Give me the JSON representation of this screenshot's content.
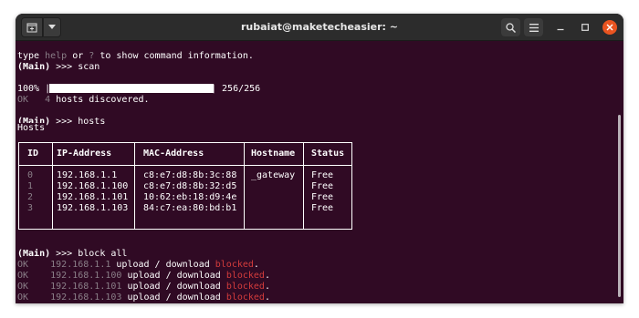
{
  "window": {
    "title": "rubaiat@maketecheasier: ~"
  },
  "colors": {
    "terminal_bg": "#300a24",
    "titlebar_bg": "#2c2c2c",
    "close_button": "#e95420",
    "blocked_red": "#d43c3c",
    "dim_text": "#8a7f88"
  },
  "icons": {
    "new_tab": "new-tab-icon",
    "dropdown": "chevron-down-icon",
    "search": "search-icon",
    "menu": "hamburger-icon",
    "minimize": "minimize-icon",
    "maximize": "maximize-icon",
    "close": "close-icon"
  },
  "terminal": {
    "help_line": {
      "pre": "type ",
      "help": "help",
      "mid": " or ",
      "q": "?",
      "post": " to show command information."
    },
    "prompt": "(Main)",
    "arrows": " >>> ",
    "cmd_scan": "scan",
    "progress": {
      "percent_label": "100% |",
      "end_label": "| 256/256",
      "fraction": 1.0
    },
    "ok_label": "OK",
    "discovered": {
      "count": "4",
      "text": " hosts discovered."
    },
    "cmd_hosts": "hosts",
    "hosts_table": {
      "label": "Hosts",
      "headers": [
        "ID",
        "IP-Address",
        "MAC-Address",
        "Hostname",
        "Status"
      ],
      "rows": [
        {
          "id": "0",
          "ip": "192.168.1.1",
          "mac": "c8:e7:d8:8b:3c:88",
          "hostname": "_gateway",
          "status": "Free"
        },
        {
          "id": "1",
          "ip": "192.168.1.100",
          "mac": "c8:e7:d8:8b:32:d5",
          "hostname": "",
          "status": "Free"
        },
        {
          "id": "2",
          "ip": "192.168.1.101",
          "mac": "10:62:eb:18:d9:4e",
          "hostname": "",
          "status": "Free"
        },
        {
          "id": "3",
          "ip": "192.168.1.103",
          "mac": "84:c7:ea:80:bd:b1",
          "hostname": "",
          "status": "Free"
        }
      ]
    },
    "cmd_block": "block all",
    "block_results": [
      {
        "ok": "OK",
        "ip": "192.168.1.1",
        "text": " upload / download ",
        "status": "blocked",
        "end": "."
      },
      {
        "ok": "OK",
        "ip": "192.168.1.100",
        "text": " upload / download ",
        "status": "blocked",
        "end": "."
      },
      {
        "ok": "OK",
        "ip": "192.168.1.101",
        "text": " upload / download ",
        "status": "blocked",
        "end": "."
      },
      {
        "ok": "OK",
        "ip": "192.168.1.103",
        "text": " upload / download ",
        "status": "blocked",
        "end": "."
      }
    ]
  }
}
